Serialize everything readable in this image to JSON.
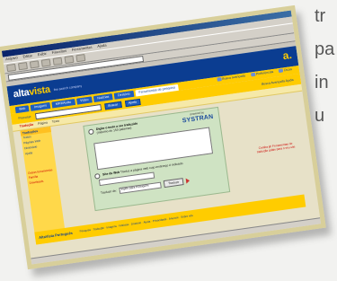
{
  "page_text": {
    "lines": [
      "tr",
      "pa",
      "in",
      "u"
    ]
  },
  "browser": {
    "menu": [
      "Arquivo",
      "Editar",
      "Exibir",
      "Favoritos",
      "Ferramentas",
      "Ajuda"
    ]
  },
  "altavista": {
    "logo_alta": "alta",
    "logo_vista": "vista",
    "tagline": "the search company",
    "right_logo": "a.",
    "tabs": [
      "Web",
      "Imagens",
      "MP3/Áudio",
      "Vídeo",
      "Notícias",
      "Diretório",
      "Ferramentas de pesquisa"
    ],
    "active_tab_index": 6,
    "top_links": [
      "Busca avançada",
      "Preferências",
      "Dicas"
    ],
    "search_label": "Procurar:",
    "search_button": "Buscar",
    "search_button_2": "Ajuda",
    "search_right": "Busca Avançada  Ajuda",
    "trans_bar": [
      "Tradução",
      "Página",
      "Texto"
    ]
  },
  "sidebar": {
    "header": "Traduções",
    "links": [
      "Textos",
      "Páginas Web",
      "Dicionário",
      "Ajuda"
    ],
    "links_bottom": [
      "Outras ferramentas",
      "Família",
      "Downloads"
    ]
  },
  "translator": {
    "radio1_label_bold": "Digite o texto a ser traduzido",
    "radio1_label": "(máximo de 150 palavras)",
    "powered_by": "powered by",
    "provider": "SYSTRAN",
    "radio2_label_bold": "Site da Web",
    "radio2_label": "Traduz a página web cujo endereço é indicado",
    "lang_label": "Traduzir de:",
    "lang_value": "Inglês para Português",
    "translate_button": "Traduzir"
  },
  "promo": {
    "text": "Confira já! Ferramentas de tradução grátis para o seu site"
  },
  "footer": {
    "brand": "AltaVista Português",
    "links": "Pesquisa · Tradução · Imagens · Notícias · Diretório · Ajuda · Privacidade · Anuncie · Sobre nós"
  }
}
